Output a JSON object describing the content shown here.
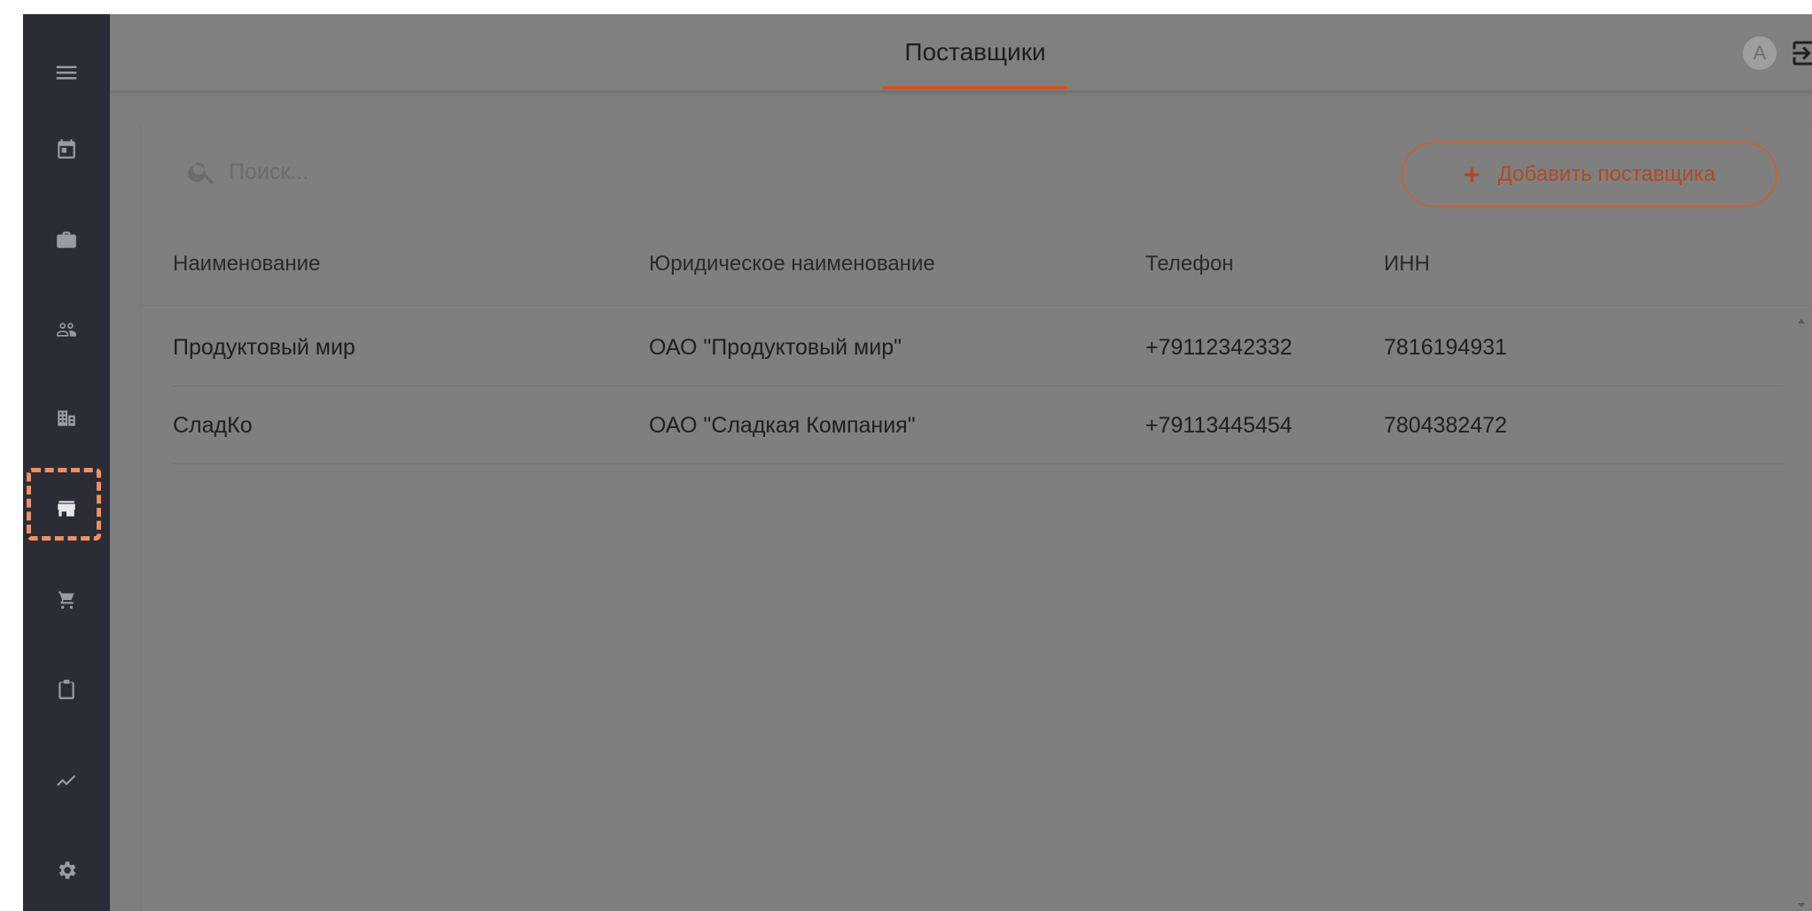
{
  "header": {
    "tab_label": "Поставщики",
    "avatar_letter": "A"
  },
  "sidebar": {
    "items": [
      {
        "name": "menu",
        "icon": "hamburger-icon"
      },
      {
        "name": "calendar",
        "icon": "calendar-icon"
      },
      {
        "name": "briefcase",
        "icon": "briefcase-icon"
      },
      {
        "name": "people",
        "icon": "people-icon"
      },
      {
        "name": "buildings",
        "icon": "buildings-icon"
      },
      {
        "name": "store",
        "icon": "store-icon",
        "active": true
      },
      {
        "name": "cart",
        "icon": "cart-icon"
      },
      {
        "name": "clipboard",
        "icon": "clipboard-icon"
      },
      {
        "name": "trending",
        "icon": "trending-icon"
      },
      {
        "name": "settings",
        "icon": "gear-icon"
      }
    ]
  },
  "search": {
    "placeholder": "Поиск..."
  },
  "toolbar": {
    "add_plus": "+",
    "add_label": "Добавить поставщика"
  },
  "table": {
    "columns": [
      "Наименование",
      "Юридическое наименование",
      "Телефон",
      "ИНН"
    ],
    "rows": [
      [
        "Продуктовый мир",
        "ОАО \"Продуктовый мир\"",
        "+79112342332",
        "7816194931"
      ],
      [
        "СладКо",
        "ОАО \"Сладкая Компания\"",
        "+79113445454",
        "7804382472"
      ]
    ]
  },
  "colors": {
    "sidebar_bg": "#2a2d36",
    "overlay_bg": "#7e7e7e",
    "accent": "#d05525",
    "highlight": "#f09060"
  }
}
